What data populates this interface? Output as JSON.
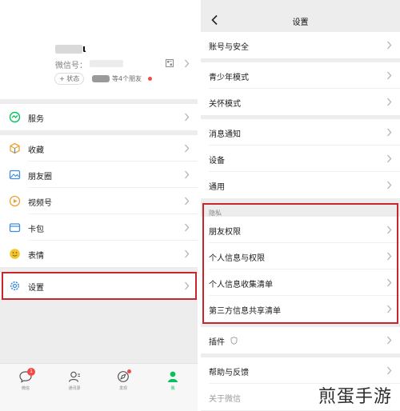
{
  "profile": {
    "name_suffix": "ι",
    "wechat_id_label": "微信号：",
    "status_label": "+ 状态",
    "friends_text": "等4个朋友"
  },
  "me_menu": {
    "services": "服务",
    "favorites": "收藏",
    "moments": "朋友圈",
    "channels": "视频号",
    "cards": "卡包",
    "stickers": "表情",
    "settings": "设置"
  },
  "tabbar": {
    "chats": "微信",
    "chats_badge": "1",
    "contacts": "通讯录",
    "discover": "发现",
    "me": "我"
  },
  "settings": {
    "title": "设置",
    "account_security": "账号与安全",
    "teen_mode": "青少年模式",
    "care_mode": "关怀模式",
    "notifications": "消息通知",
    "devices": "设备",
    "general": "通用",
    "privacy_header": "隐私",
    "friend_permissions": "朋友权限",
    "personal_info_permissions": "个人信息与权限",
    "personal_info_collection": "个人信息收集清单",
    "third_party_sharing": "第三方信息共享清单",
    "plugins": "插件",
    "help_feedback": "帮助与反馈",
    "about": "关于微信"
  },
  "watermark": "煎蛋手游",
  "colors": {
    "highlight_border": "#c9252c",
    "wechat_green": "#07c160",
    "badge_red": "#f04a4a"
  },
  "icons": [
    "qr-code-icon",
    "services-icon",
    "favorites-icon",
    "moments-icon",
    "channels-icon",
    "cards-icon",
    "stickers-icon",
    "gear-icon",
    "chat-icon",
    "contacts-icon",
    "discover-icon",
    "me-icon",
    "back-icon",
    "shield-icon",
    "chevron-right-icon"
  ]
}
